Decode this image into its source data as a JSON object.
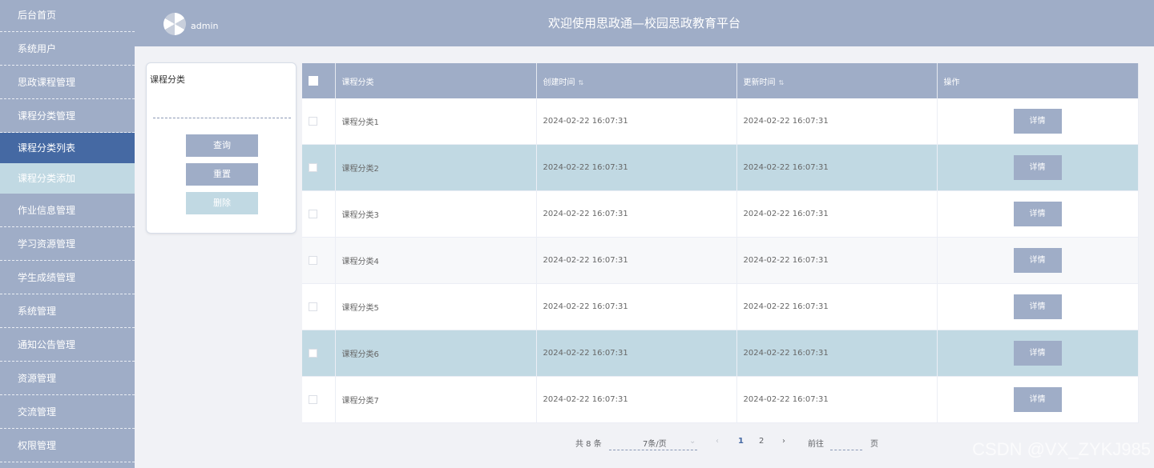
{
  "sidebar": {
    "items": [
      {
        "label": "后台首页"
      },
      {
        "label": "系统用户"
      },
      {
        "label": "思政课程管理"
      },
      {
        "label": "课程分类管理"
      },
      {
        "label": "课程分类列表"
      },
      {
        "label": "课程分类添加"
      },
      {
        "label": "作业信息管理"
      },
      {
        "label": "学习资源管理"
      },
      {
        "label": "学生成绩管理"
      },
      {
        "label": "系统管理"
      },
      {
        "label": "通知公告管理"
      },
      {
        "label": "资源管理"
      },
      {
        "label": "交流管理"
      },
      {
        "label": "权限管理"
      }
    ]
  },
  "header": {
    "username": "admin",
    "title": "欢迎使用思政通—校园思政教育平台"
  },
  "search": {
    "label": "课程分类",
    "input_value": "",
    "query_label": "查询",
    "reset_label": "重置",
    "delete_label": "删除"
  },
  "table": {
    "headers": {
      "category": "课程分类",
      "created": "创建时间",
      "updated": "更新时间",
      "action": "操作"
    },
    "rows": [
      {
        "category": "课程分类1",
        "created": "2024-02-22 16:07:31",
        "updated": "2024-02-22 16:07:31",
        "action": "详情"
      },
      {
        "category": "课程分类2",
        "created": "2024-02-22 16:07:31",
        "updated": "2024-02-22 16:07:31",
        "action": "详情"
      },
      {
        "category": "课程分类3",
        "created": "2024-02-22 16:07:31",
        "updated": "2024-02-22 16:07:31",
        "action": "详情"
      },
      {
        "category": "课程分类4",
        "created": "2024-02-22 16:07:31",
        "updated": "2024-02-22 16:07:31",
        "action": "详情"
      },
      {
        "category": "课程分类5",
        "created": "2024-02-22 16:07:31",
        "updated": "2024-02-22 16:07:31",
        "action": "详情"
      },
      {
        "category": "课程分类6",
        "created": "2024-02-22 16:07:31",
        "updated": "2024-02-22 16:07:31",
        "action": "详情"
      },
      {
        "category": "课程分类7",
        "created": "2024-02-22 16:07:31",
        "updated": "2024-02-22 16:07:31",
        "action": "详情"
      }
    ]
  },
  "pagination": {
    "total": "共 8 条",
    "page_size": "7条/页",
    "pages": [
      "1",
      "2"
    ],
    "current_page": "1",
    "goto_prefix": "前往",
    "goto_suffix": "页"
  },
  "watermark": "CSDN @VX_ZYKJ985",
  "colors": {
    "primary": "#9fadc7",
    "active": "#4569a3",
    "highlight": "#c1d9e3"
  }
}
